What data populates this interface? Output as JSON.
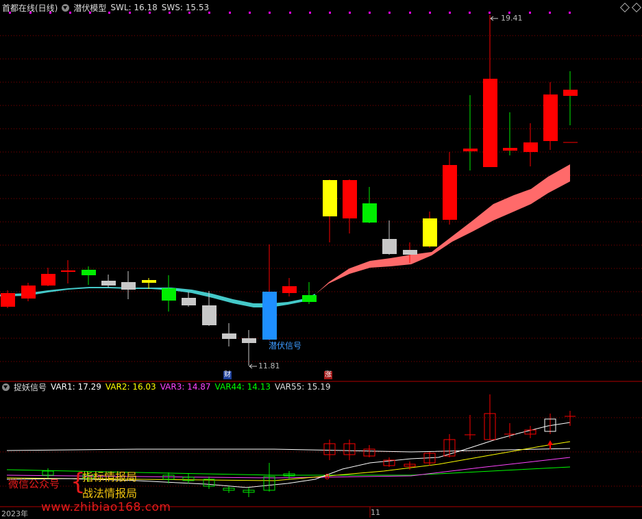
{
  "top_header": {
    "title": "首都在线(日线)",
    "indicator": "潜伏模型",
    "swl": "SWL: 16.18",
    "sws": "SWS: 15.53"
  },
  "top_chart": {
    "high_label": "19.41",
    "low_label": "11.81",
    "signal_label": "潜伏信号",
    "badge_cai": "财",
    "badge_zhang": "涨"
  },
  "bottom_header": {
    "indicator": "捉妖信号",
    "var1": "VAR1: 17.29",
    "var2": "VAR2: 16.03",
    "var3": "VAR3: 14.87",
    "var44": "VAR44: 14.13",
    "var55": "VAR55: 15.19"
  },
  "x_axis": {
    "year_label": "2023年",
    "month_label": "11"
  },
  "watermark": {
    "wechat": "微信公众号",
    "brace": "{",
    "line1": "指标情报局",
    "line2": "战法情报局",
    "site": "www.zhibiao168.com"
  },
  "colors": {
    "up": "#ff0000",
    "down": "#00ee00",
    "signal": "#1e8fff",
    "yellow": "#ffff00",
    "gray": "#c8c8c8",
    "band_cyan": "#44c8c8",
    "band_pink": "#ff6a6a",
    "var1": "#ffffff",
    "var2": "#ffff00",
    "var3": "#ff44ff",
    "var44": "#00ff00",
    "var55": "#ffffff"
  }
}
